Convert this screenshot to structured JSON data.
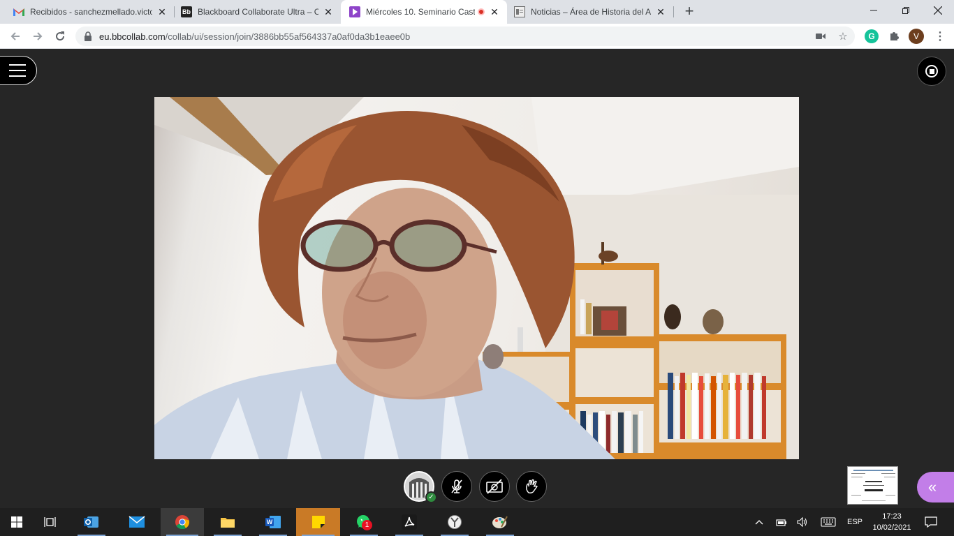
{
  "browser": {
    "tabs": [
      {
        "title": "Recibidos - sanchezmellado.victo",
        "icon": "gmail-icon",
        "active": false
      },
      {
        "title": "Blackboard Collaborate Ultra – Cl",
        "icon": "blackboard-icon",
        "active": false
      },
      {
        "title": "Miércoles 10. Seminario Cast",
        "icon": "collaborate-icon",
        "active": true,
        "recording": true
      },
      {
        "title": "Noticias – Área de Historia del Ar",
        "icon": "site-icon",
        "active": false
      }
    ],
    "new_tab_label": "+",
    "url_host": "eu.bbcollab.com",
    "url_path": "/collab/ui/session/join/3886bb55af564337a0af0da3b1eaee0b",
    "profile_initial": "V",
    "grammarly_letter": "G"
  },
  "session": {
    "menu_icon": "hamburger-icon",
    "record_icon": "stop-record-icon",
    "controls": [
      {
        "name": "avatar-status-button",
        "icon": "avatar-icon"
      },
      {
        "name": "microphone-toggle",
        "icon": "mic-off-icon"
      },
      {
        "name": "camera-toggle",
        "icon": "camera-off-icon"
      },
      {
        "name": "raise-hand-button",
        "icon": "hand-icon"
      }
    ],
    "panel_toggle_icon": "double-chevron-left-icon"
  },
  "taskbar": {
    "apps": [
      "start",
      "task-view",
      "outlook",
      "mail",
      "chrome",
      "file-explorer",
      "word",
      "sticky-notes",
      "whatsapp",
      "acrobat",
      "yarn",
      "paint"
    ],
    "whatsapp_badge": "1",
    "language": "ESP",
    "time": "17:23",
    "date": "10/02/2021"
  },
  "colors": {
    "session_bg": "#262626",
    "panel_accent": "#c27ee8",
    "sticky_active": "#c97a26"
  }
}
